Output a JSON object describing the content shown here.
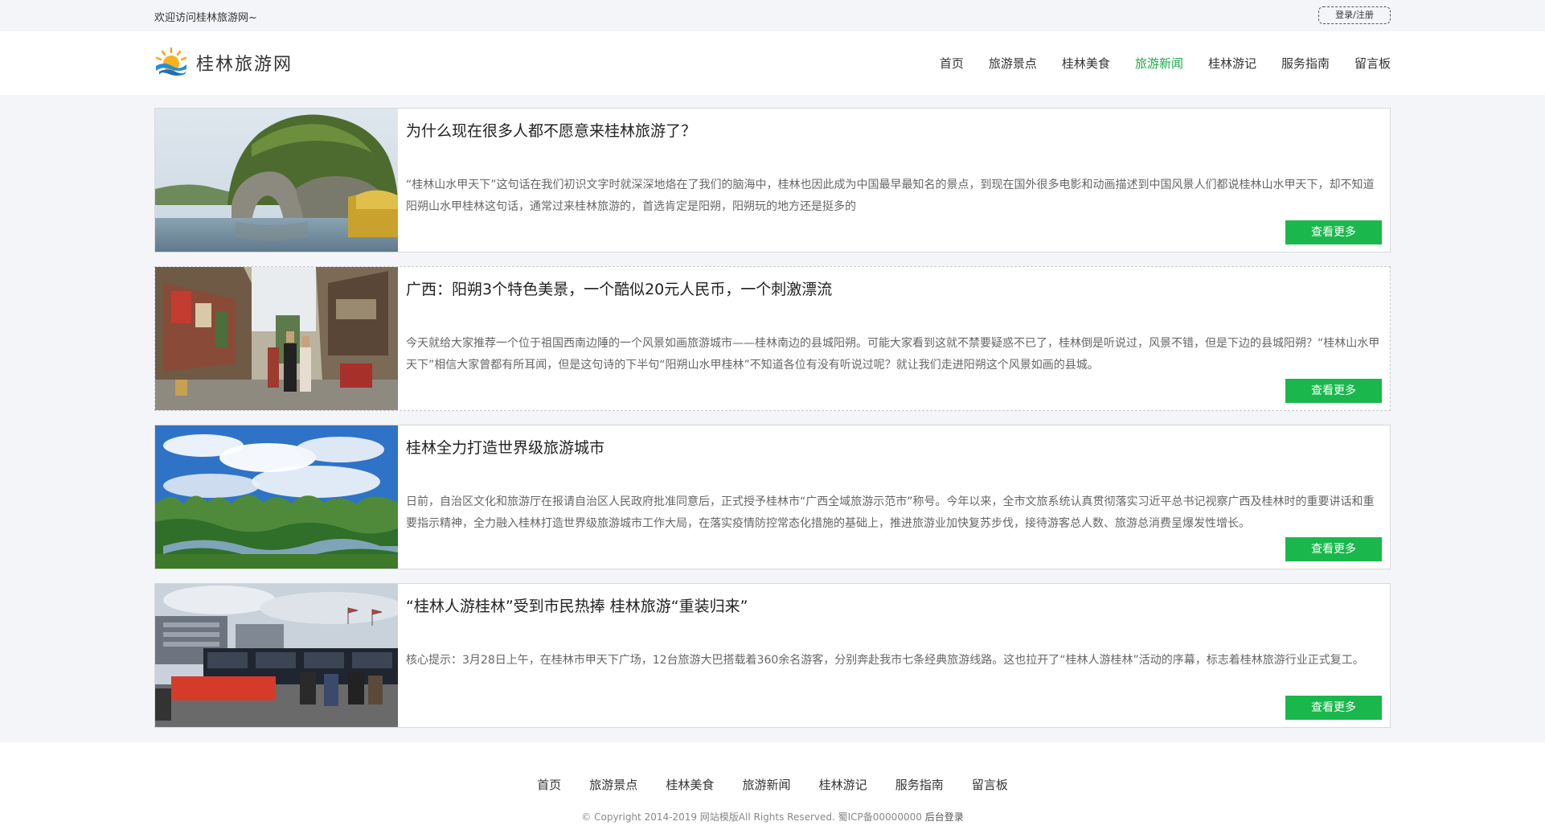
{
  "topbar": {
    "welcome": "欢迎访问桂林旅游网~",
    "login": "登录/注册"
  },
  "header": {
    "site_name": "桂林旅游网",
    "nav": [
      "首页",
      "旅游景点",
      "桂林美食",
      "旅游新闻",
      "桂林游记",
      "服务指南",
      "留言板"
    ],
    "active_nav": "旅游新闻",
    "accent_color": "#1aaa4a"
  },
  "articles": [
    {
      "title": "为什么现在很多人都不愿意来桂林旅游了？",
      "desc": "“桂林山水甲天下”这句话在我们初识文字时就深深地烙在了我们的脑海中，桂林也因此成为中国最早最知名的景点，到现在国外很多电影和动画描述到中国风景人们都说桂林山水甲天下，却不知道阳朔山水甲桂林这句话，通常过来桂林旅游的，首选肯定是阳朔，阳朔玩的地方还是挺多的",
      "button": "查看更多"
    },
    {
      "title": "广西：阳朔3个特色美景，一个酷似20元人民币，一个刺激漂流",
      "desc": "今天就给大家推荐一个位于祖国西南边陲的一个风景如画旅游城市——桂林南边的县城阳朔。可能大家看到这就不禁要疑惑不已了，桂林倒是听说过，风景不错，但是下边的县城阳朔？“桂林山水甲天下”相信大家曾都有所耳闻，但是这句诗的下半句“阳朔山水甲桂林”不知道各位有没有听说过呢？就让我们走进阳朔这个风景如画的县城。",
      "button": "查看更多"
    },
    {
      "title": "桂林全力打造世界级旅游城市",
      "desc": "日前，自治区文化和旅游厅在报请自治区人民政府批准同意后，正式授予桂林市“广西全域旅游示范市”称号。今年以来，全市文旅系统认真贯彻落实习近平总书记视察广西及桂林时的重要讲话和重要指示精神，全力融入桂林打造世界级旅游城市工作大局，在落实疫情防控常态化措施的基础上，推进旅游业加快复苏步伐，接待游客总人数、旅游总消费呈爆发性增长。",
      "button": "查看更多"
    },
    {
      "title": "“桂林人游桂林”受到市民热捧 桂林旅游“重装归来”",
      "desc": "核心提示：3月28日上午，在桂林市甲天下广场，12台旅游大巴搭载着360余名游客，分别奔赴我市七条经典旅游线路。这也拉开了“桂林人游桂林”活动的序幕，标志着桂林旅游行业正式复工。",
      "button": "查看更多"
    }
  ],
  "footer": {
    "nav": [
      "首页",
      "旅游景点",
      "桂林美食",
      "旅游新闻",
      "桂林游记",
      "服务指南",
      "留言板"
    ],
    "copyright": "© Copyright 2014-2019 网站模版All Rights Reserved. 蜀ICP备00000000",
    "admin_link": "后台登录"
  }
}
